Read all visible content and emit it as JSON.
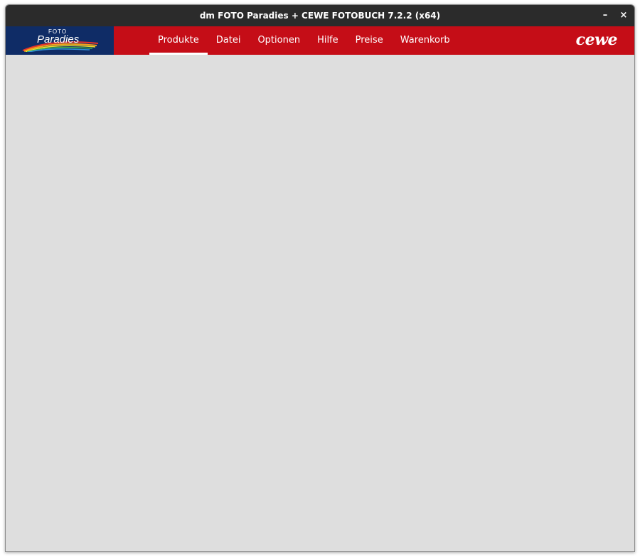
{
  "window": {
    "title": "dm FOTO Paradies + CEWE FOTOBUCH 7.2.2 (x64)",
    "minimize_symbol": "–",
    "close_symbol": "×"
  },
  "logo": {
    "line1": "FOTO",
    "line2": "Paradies"
  },
  "menu": {
    "items": [
      {
        "label": "Produkte",
        "active": true
      },
      {
        "label": "Datei",
        "active": false
      },
      {
        "label": "Optionen",
        "active": false
      },
      {
        "label": "Hilfe",
        "active": false
      },
      {
        "label": "Preise",
        "active": false
      },
      {
        "label": "Warenkorb",
        "active": false
      }
    ]
  },
  "brand": {
    "text": "cewe"
  },
  "colors": {
    "titlebar": "#2b2b2b",
    "menubar": "#c50d17",
    "logo_bg": "#0f2c66",
    "content_bg": "#dedede"
  }
}
